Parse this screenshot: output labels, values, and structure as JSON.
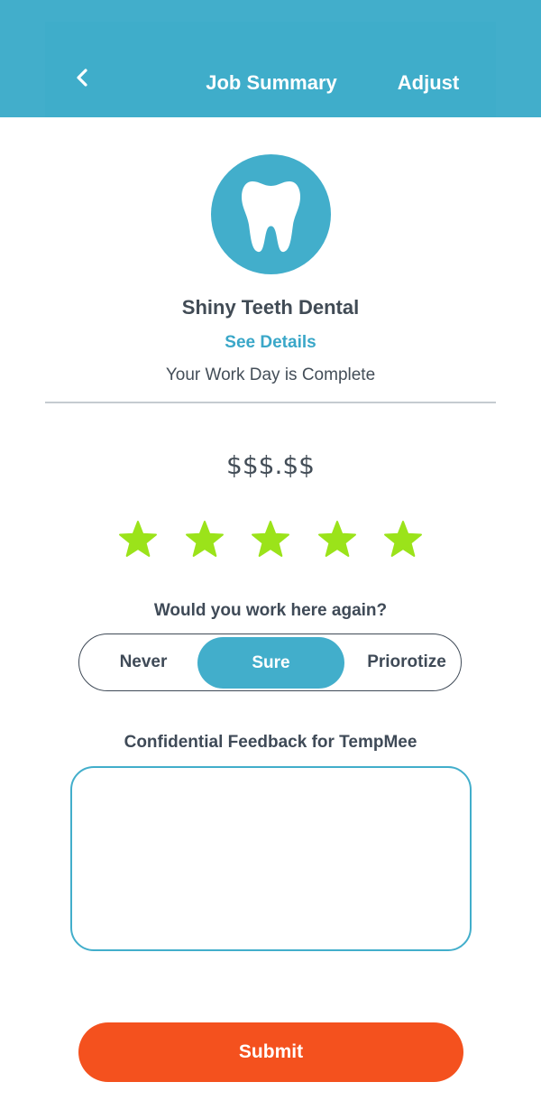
{
  "header": {
    "back_icon": "chevron-left-icon",
    "title": "Job Summary",
    "action_label": "Adjust",
    "color": "#42aecb"
  },
  "office": {
    "logo_icon": "tooth-icon",
    "name": "Shiny Teeth Dental",
    "details_link": "See Details",
    "status_text": "Your Work Day is Complete"
  },
  "payment": {
    "amount": "$$$.$$"
  },
  "rating": {
    "value": 5,
    "max": 5,
    "star_color": "#9be31a"
  },
  "work_again": {
    "question": "Would you work here again?",
    "options": [
      "Never",
      "Sure",
      "Priorotize"
    ],
    "selected": "Sure"
  },
  "feedback": {
    "label": "Confidential Feedback for TempMee",
    "value": ""
  },
  "submit": {
    "label": "Submit",
    "color": "#f4511e"
  }
}
